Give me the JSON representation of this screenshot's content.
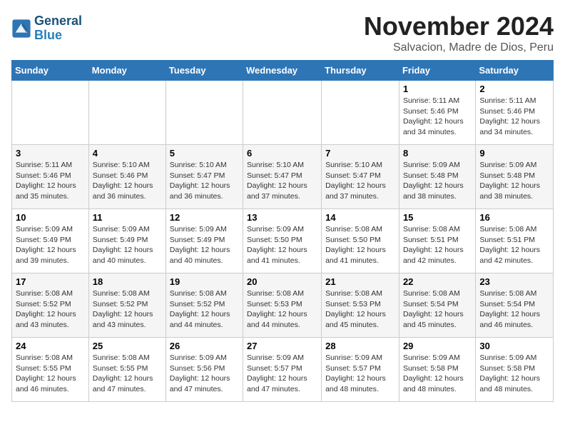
{
  "header": {
    "logo_line1": "General",
    "logo_line2": "Blue",
    "month_title": "November 2024",
    "subtitle": "Salvacion, Madre de Dios, Peru"
  },
  "weekdays": [
    "Sunday",
    "Monday",
    "Tuesday",
    "Wednesday",
    "Thursday",
    "Friday",
    "Saturday"
  ],
  "weeks": [
    [
      {
        "day": "",
        "detail": ""
      },
      {
        "day": "",
        "detail": ""
      },
      {
        "day": "",
        "detail": ""
      },
      {
        "day": "",
        "detail": ""
      },
      {
        "day": "",
        "detail": ""
      },
      {
        "day": "1",
        "detail": "Sunrise: 5:11 AM\nSunset: 5:46 PM\nDaylight: 12 hours\nand 34 minutes."
      },
      {
        "day": "2",
        "detail": "Sunrise: 5:11 AM\nSunset: 5:46 PM\nDaylight: 12 hours\nand 34 minutes."
      }
    ],
    [
      {
        "day": "3",
        "detail": "Sunrise: 5:11 AM\nSunset: 5:46 PM\nDaylight: 12 hours\nand 35 minutes."
      },
      {
        "day": "4",
        "detail": "Sunrise: 5:10 AM\nSunset: 5:46 PM\nDaylight: 12 hours\nand 36 minutes."
      },
      {
        "day": "5",
        "detail": "Sunrise: 5:10 AM\nSunset: 5:47 PM\nDaylight: 12 hours\nand 36 minutes."
      },
      {
        "day": "6",
        "detail": "Sunrise: 5:10 AM\nSunset: 5:47 PM\nDaylight: 12 hours\nand 37 minutes."
      },
      {
        "day": "7",
        "detail": "Sunrise: 5:10 AM\nSunset: 5:47 PM\nDaylight: 12 hours\nand 37 minutes."
      },
      {
        "day": "8",
        "detail": "Sunrise: 5:09 AM\nSunset: 5:48 PM\nDaylight: 12 hours\nand 38 minutes."
      },
      {
        "day": "9",
        "detail": "Sunrise: 5:09 AM\nSunset: 5:48 PM\nDaylight: 12 hours\nand 38 minutes."
      }
    ],
    [
      {
        "day": "10",
        "detail": "Sunrise: 5:09 AM\nSunset: 5:49 PM\nDaylight: 12 hours\nand 39 minutes."
      },
      {
        "day": "11",
        "detail": "Sunrise: 5:09 AM\nSunset: 5:49 PM\nDaylight: 12 hours\nand 40 minutes."
      },
      {
        "day": "12",
        "detail": "Sunrise: 5:09 AM\nSunset: 5:49 PM\nDaylight: 12 hours\nand 40 minutes."
      },
      {
        "day": "13",
        "detail": "Sunrise: 5:09 AM\nSunset: 5:50 PM\nDaylight: 12 hours\nand 41 minutes."
      },
      {
        "day": "14",
        "detail": "Sunrise: 5:08 AM\nSunset: 5:50 PM\nDaylight: 12 hours\nand 41 minutes."
      },
      {
        "day": "15",
        "detail": "Sunrise: 5:08 AM\nSunset: 5:51 PM\nDaylight: 12 hours\nand 42 minutes."
      },
      {
        "day": "16",
        "detail": "Sunrise: 5:08 AM\nSunset: 5:51 PM\nDaylight: 12 hours\nand 42 minutes."
      }
    ],
    [
      {
        "day": "17",
        "detail": "Sunrise: 5:08 AM\nSunset: 5:52 PM\nDaylight: 12 hours\nand 43 minutes."
      },
      {
        "day": "18",
        "detail": "Sunrise: 5:08 AM\nSunset: 5:52 PM\nDaylight: 12 hours\nand 43 minutes."
      },
      {
        "day": "19",
        "detail": "Sunrise: 5:08 AM\nSunset: 5:52 PM\nDaylight: 12 hours\nand 44 minutes."
      },
      {
        "day": "20",
        "detail": "Sunrise: 5:08 AM\nSunset: 5:53 PM\nDaylight: 12 hours\nand 44 minutes."
      },
      {
        "day": "21",
        "detail": "Sunrise: 5:08 AM\nSunset: 5:53 PM\nDaylight: 12 hours\nand 45 minutes."
      },
      {
        "day": "22",
        "detail": "Sunrise: 5:08 AM\nSunset: 5:54 PM\nDaylight: 12 hours\nand 45 minutes."
      },
      {
        "day": "23",
        "detail": "Sunrise: 5:08 AM\nSunset: 5:54 PM\nDaylight: 12 hours\nand 46 minutes."
      }
    ],
    [
      {
        "day": "24",
        "detail": "Sunrise: 5:08 AM\nSunset: 5:55 PM\nDaylight: 12 hours\nand 46 minutes."
      },
      {
        "day": "25",
        "detail": "Sunrise: 5:08 AM\nSunset: 5:55 PM\nDaylight: 12 hours\nand 47 minutes."
      },
      {
        "day": "26",
        "detail": "Sunrise: 5:09 AM\nSunset: 5:56 PM\nDaylight: 12 hours\nand 47 minutes."
      },
      {
        "day": "27",
        "detail": "Sunrise: 5:09 AM\nSunset: 5:57 PM\nDaylight: 12 hours\nand 47 minutes."
      },
      {
        "day": "28",
        "detail": "Sunrise: 5:09 AM\nSunset: 5:57 PM\nDaylight: 12 hours\nand 48 minutes."
      },
      {
        "day": "29",
        "detail": "Sunrise: 5:09 AM\nSunset: 5:58 PM\nDaylight: 12 hours\nand 48 minutes."
      },
      {
        "day": "30",
        "detail": "Sunrise: 5:09 AM\nSunset: 5:58 PM\nDaylight: 12 hours\nand 48 minutes."
      }
    ]
  ]
}
